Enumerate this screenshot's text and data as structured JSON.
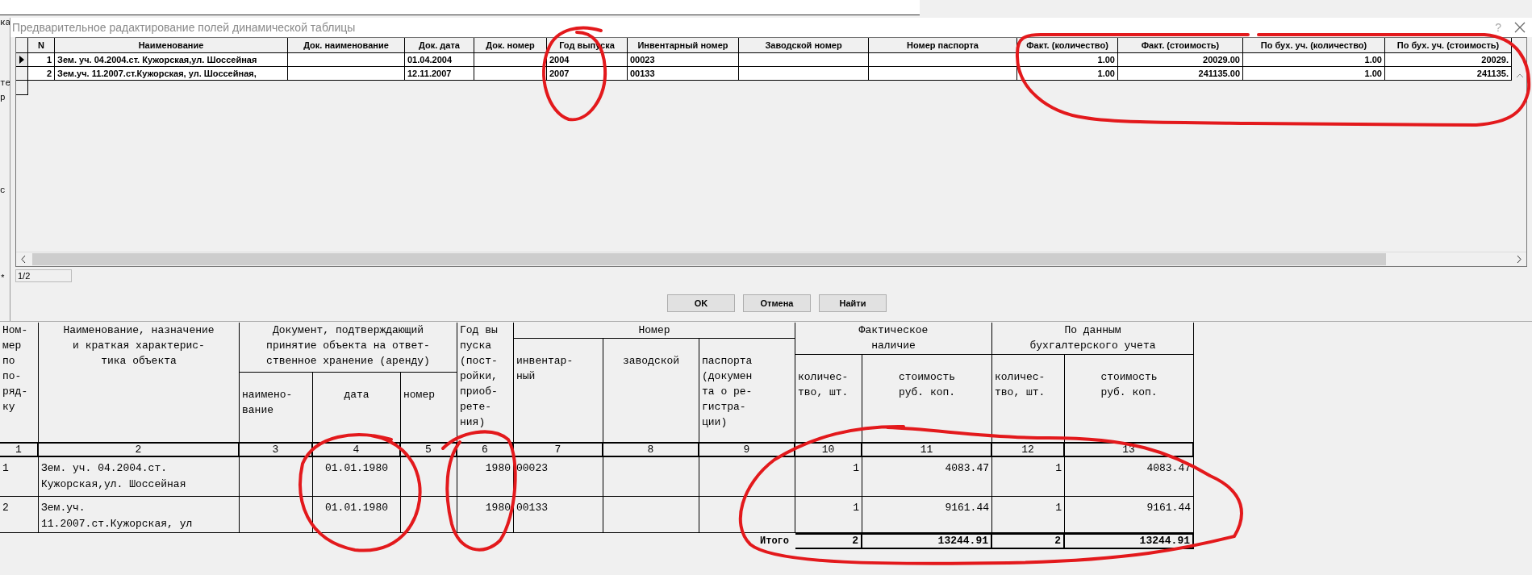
{
  "background": {
    "fragments": [
      "ка",
      "те",
      "р",
      "с",
      "*"
    ]
  },
  "dialog": {
    "title": "Предварительное радактирование полей динамической таблицы",
    "help": "?"
  },
  "grid": {
    "columns": [
      "N",
      "Наименование",
      "Док. наименование",
      "Док. дата",
      "Док. номер",
      "Год выпуска",
      "Инвентарный номер",
      "Заводской номер",
      "Номер паспорта",
      "Факт. (количество)",
      "Факт. (стоимость)",
      "По бух. уч. (количество)",
      "По бух. уч. (стоимость)"
    ],
    "rows": [
      {
        "selected": true,
        "cells": [
          "1",
          "Зем. уч. 04.2004.ст. Кужорская,ул. Шоссейная",
          "",
          "01.04.2004",
          "",
          "2004",
          "00023",
          "",
          "",
          "1.00",
          "20029.00",
          "1.00",
          "20029."
        ]
      },
      {
        "selected": false,
        "cells": [
          "2",
          "Зем.уч. 11.2007.ст.Кужорская, ул. Шоссейная,",
          "",
          "12.11.2007",
          "",
          "2007",
          "00133",
          "",
          "",
          "1.00",
          "241135.00",
          "1.00",
          "241135."
        ]
      }
    ],
    "status": "1/2"
  },
  "buttons": [
    "OK",
    "Отмена",
    "Найти"
  ],
  "report": {
    "header": {
      "number": "Ном-\nмер\nпо\nпо-\nряд-\nку",
      "name": "Наименование, назначение\nи краткая характерис-\nтика объекта",
      "doc": "Документ, подтверждающий\nпринятие объекта на ответ-\nственное хранение (аренду)",
      "doc_name": "наимено-\nвание",
      "doc_date": "дата",
      "doc_no": "номер",
      "year": "Год вы\nпуска\n(пост-\nройки,\nприоб-\nрете-\nния)",
      "num": "Номер",
      "inv": "инвентар-\nный",
      "factory": "заводской",
      "passport": "паспорта\n(докумен\nта о ре-\nгистра-\nции)",
      "fact": "Фактическое\nналичие",
      "fact_qty": "количес-\nтво, шт.",
      "fact_cost": "стоимость\nруб. коп.",
      "book": "По данным\nбухгалтерского учета",
      "book_qty": "количес-\nтво, шт.",
      "book_cost": "стоимость\nруб. коп."
    },
    "column_numbers": [
      "1",
      "2",
      "3",
      "4",
      "5",
      "6",
      "7",
      "8",
      "9",
      "10",
      "11",
      "12",
      "13"
    ],
    "rows": [
      [
        "1",
        "Зем. уч. 04.2004.ст.\nКужорская,ул. Шоссейная",
        "",
        "01.01.1980",
        "",
        "1980",
        "00023",
        "",
        "",
        "1",
        "4083.47",
        "1",
        "4083.47"
      ],
      [
        "2",
        "Зем.уч.\n11.2007.ст.Кужорская, ул",
        "",
        "01.01.1980",
        "",
        "1980",
        "00133",
        "",
        "",
        "1",
        "9161.44",
        "1",
        "9161.44"
      ]
    ],
    "total": {
      "label": "Итого",
      "values": [
        "2",
        "13244.91",
        "2",
        "13244.91"
      ]
    }
  }
}
